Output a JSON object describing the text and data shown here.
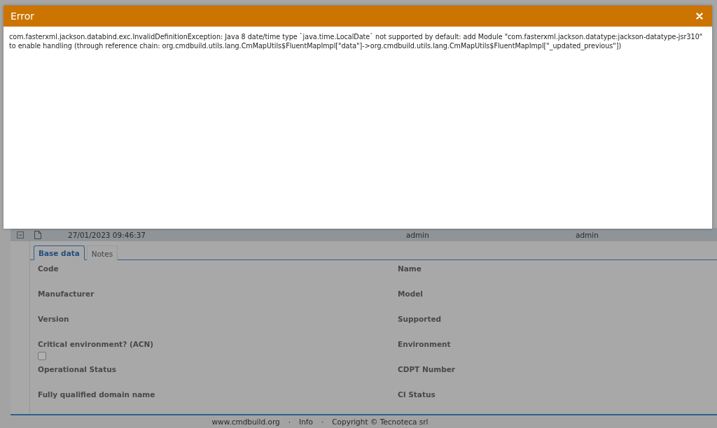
{
  "error_dialog": {
    "title": "Error",
    "message": "com.fasterxml.jackson.databind.exc.InvalidDefinitionException: Java 8 date/time type `java.time.LocalDate` not supported by default: add Module \"com.fasterxml.jackson.datatype:jackson-datatype-jsr310\" to enable handling (through reference chain: org.cmdbuild.utils.lang.CmMapUtils$FluentMapImpl[\"data\"]->org.cmdbuild.utils.lang.CmMapUtils$FluentMapImpl[\"_updated_previous\"])"
  },
  "record_row": {
    "expanded": true,
    "date": "27/01/2023 09:46:37",
    "column_3": "admin",
    "column_4": "admin"
  },
  "tabs": [
    {
      "label": "Base data",
      "selected": true
    },
    {
      "label": "Notes",
      "selected": false
    }
  ],
  "fields": [
    {
      "label": "Code",
      "kind": "text"
    },
    {
      "label": "Name",
      "kind": "text"
    },
    {
      "label": "Manufacturer",
      "kind": "text"
    },
    {
      "label": "Model",
      "kind": "text"
    },
    {
      "label": "Version",
      "kind": "text"
    },
    {
      "label": "Supported",
      "kind": "text"
    },
    {
      "label": "Critical environment? (ACN)",
      "kind": "checkbox",
      "checked": false
    },
    {
      "label": "Environment",
      "kind": "text"
    },
    {
      "label": "Operational Status",
      "kind": "text"
    },
    {
      "label": "CDPT Number",
      "kind": "text"
    },
    {
      "label": "Fully qualified domain name",
      "kind": "text"
    },
    {
      "label": "CI Status",
      "kind": "text"
    }
  ],
  "footer": {
    "links": [
      "www.cmdbuild.org",
      "Info",
      "Copyright © Tecnoteca srl"
    ],
    "separator": "·"
  }
}
